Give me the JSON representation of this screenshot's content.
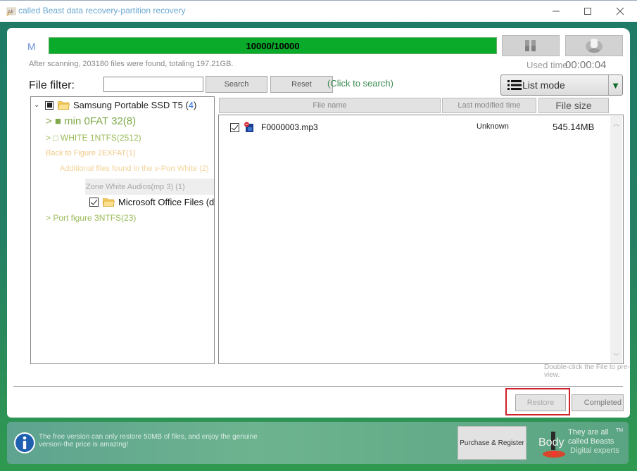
{
  "window": {
    "title": "called Beast data recovery-partition recovery",
    "controls": {
      "minimize": "—",
      "maximize": "☐",
      "close": "✕"
    }
  },
  "scan": {
    "mode_letter": "M",
    "progress_text": "10000/10000",
    "progress_fraction": 1.0,
    "summary": "After scanning, 203180 files were found, totaling 197.21GB.",
    "used_time_label": "Used time",
    "used_time_value": "00:00:04",
    "pause_icon": "pause-icon",
    "stop_icon": "stop-icon"
  },
  "filter": {
    "label": "File filter:",
    "input_value": "",
    "input_placeholder": "",
    "search_label": "Search",
    "reset_label": "Reset",
    "hint": "(Click to search)"
  },
  "view_mode": {
    "label": "List mode",
    "icon": "list-icon"
  },
  "tree": {
    "root": {
      "label": "Samsung Portable SSD T5 (",
      "count": "4",
      "suffix": ")"
    },
    "items": [
      {
        "label": "> ■ min 0FAT 32(8)"
      },
      {
        "label": "> □ WHITE 1NTFS(2512)"
      },
      {
        "label": "Back to Figure 2EXFAT(1)"
      },
      {
        "label": "Additional files found in the v-Port White (2)"
      },
      {
        "label": "Zone White Audios(mp 3) (1)"
      },
      {
        "label": "Microsoft Office Files (doc)"
      },
      {
        "label": "> Port figure 3NTFS(23)"
      }
    ]
  },
  "file_list": {
    "columns": [
      "File name",
      "Last modified time",
      "File size"
    ],
    "rows": [
      {
        "name": "F0000003.mp3",
        "modified": "Unknown",
        "size": "545.14MB",
        "checked": true
      }
    ],
    "preview_hint": "Double-click the File to pre-view."
  },
  "actions": {
    "restore_label": "Restore",
    "completed_label": "Completed"
  },
  "footer": {
    "message": "The free version can only restore 50MB of files, and enjoy the genuine version-the price is amazing!",
    "purchase_label": "Purchase & Register",
    "brand_body": "Body",
    "brand_line1": "They are all",
    "brand_line2": "called Beasts",
    "brand_line3": "Digital experts",
    "brand_tm": "TM"
  },
  "colors": {
    "accent_green": "#0aab2b",
    "frame_teal": "#1e7a66",
    "restore_highlight": "#d0202a",
    "link_blue": "#2f6fd6"
  }
}
